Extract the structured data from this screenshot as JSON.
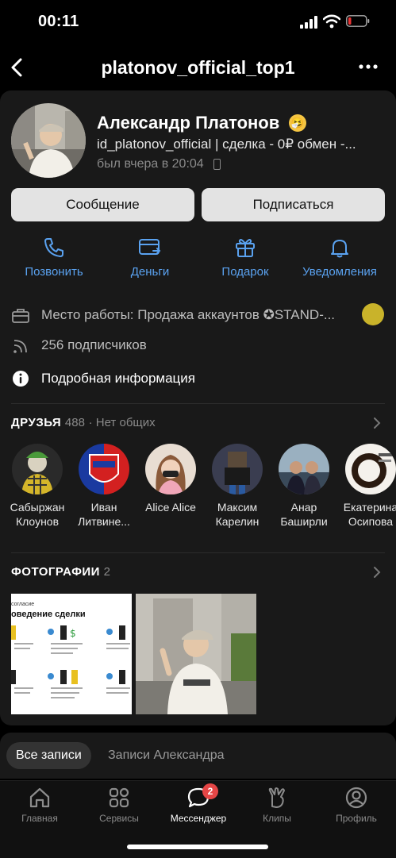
{
  "status_bar": {
    "time": "00:11"
  },
  "header": {
    "title": "platonov_official_top1"
  },
  "profile": {
    "name": "Александр Платонов",
    "emoji": "🤧",
    "status": "id_platonov_official | сделка - 0₽ обмен -...",
    "last_seen": "был вчера в 20:04"
  },
  "buttons": {
    "message": "Сообщение",
    "subscribe": "Подписаться"
  },
  "actions": [
    {
      "label": "Позвонить",
      "icon": "phone-icon"
    },
    {
      "label": "Деньги",
      "icon": "money-transfer-icon"
    },
    {
      "label": "Подарок",
      "icon": "gift-icon"
    },
    {
      "label": "Уведомления",
      "icon": "bell-icon"
    }
  ],
  "info": {
    "work": "Место работы: Продажа аккаунтов ✪STAND-...",
    "subscribers": "256 подписчиков",
    "details": "Подробная информация"
  },
  "friends_section": {
    "title": "ДРУЗЬЯ",
    "count": "488",
    "common": "· Нет общих",
    "friends": [
      {
        "first": "Сабыржан",
        "last": "Клоунов"
      },
      {
        "first": "Иван",
        "last": "Литвине..."
      },
      {
        "first": "Alice Alice",
        "last": ""
      },
      {
        "first": "Максим",
        "last": "Карелин"
      },
      {
        "first": "Анар",
        "last": "Баширли"
      },
      {
        "first": "Екатерина",
        "last": "Осипова"
      }
    ]
  },
  "photos_section": {
    "title": "ФОТОГРАФИИ",
    "count": "2",
    "photo1_heading": "оведение сделки",
    "photo1_subheading": "согласие"
  },
  "wall_tabs": {
    "all": "Все записи",
    "alexander": "Записи Александра"
  },
  "bottom_nav": {
    "items": [
      {
        "label": "Главная",
        "icon": "home-icon"
      },
      {
        "label": "Сервисы",
        "icon": "services-icon"
      },
      {
        "label": "Мессенджер",
        "icon": "messenger-icon"
      },
      {
        "label": "Клипы",
        "icon": "clips-icon"
      },
      {
        "label": "Профиль",
        "icon": "profile-icon"
      }
    ],
    "messenger_badge": "2"
  },
  "colors": {
    "accent": "#5aa2f0",
    "background": "#000000",
    "card": "#191919",
    "badge": "#e64646"
  }
}
